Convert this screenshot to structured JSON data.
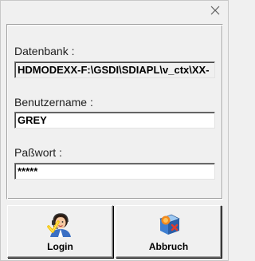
{
  "dialog": {
    "close_icon": "close-icon"
  },
  "fields": {
    "database": {
      "label": "Datenbank :",
      "value": "HDMODEXX-F:\\GSDI\\SDIAPL\\v_ctx\\XX-"
    },
    "username": {
      "label": "Benutzername :",
      "value": "GREY"
    },
    "password": {
      "label": "Paßwort :",
      "value": "*****"
    }
  },
  "buttons": {
    "login": {
      "label": "Login",
      "icon": "user-login-icon"
    },
    "cancel": {
      "label": "Abbruch",
      "icon": "cancel-icon"
    }
  }
}
